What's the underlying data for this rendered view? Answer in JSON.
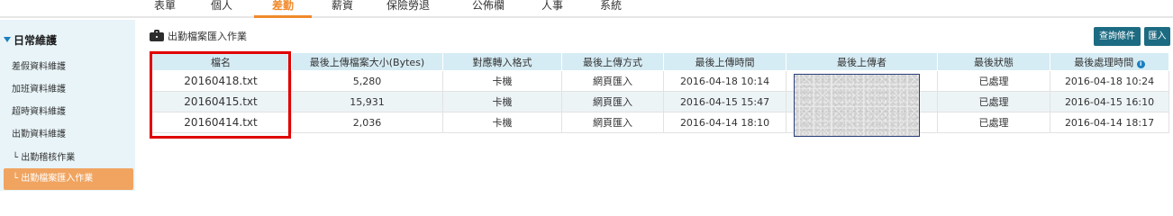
{
  "topnav": {
    "items": [
      {
        "label": "表單"
      },
      {
        "label": "個人"
      },
      {
        "label": "差勤"
      },
      {
        "label": "薪資"
      },
      {
        "label": "保險勞退"
      },
      {
        "label": "公佈欄"
      },
      {
        "label": "人事"
      },
      {
        "label": "系統"
      }
    ],
    "active_index": 2,
    "accent_color": "#f0892a"
  },
  "sidebar": {
    "section_label": "日常維護",
    "items": [
      {
        "label": "差假資料維護"
      },
      {
        "label": "加班資料維護"
      },
      {
        "label": "超時資料維護"
      },
      {
        "label": "出勤資料維護"
      },
      {
        "label": "└ 出勤稽核作業"
      },
      {
        "label": "└ 出勤檔案匯入作業"
      }
    ],
    "active_color": "#f0a460"
  },
  "main": {
    "title": "出勤檔案匯入作業",
    "title_icon": "briefcase-icon",
    "query_button": "查詢條件",
    "import_button": "匯入",
    "button_color": "#1c6b82"
  },
  "table": {
    "headers": [
      "檔名",
      "最後上傳檔案大小(Bytes)",
      "對應轉入格式",
      "最後上傳方式",
      "最後上傳時間",
      "最後上傳者",
      "最後狀態",
      "最後處理時間"
    ],
    "rows": [
      [
        "20160418.txt",
        "5,280",
        "卡機",
        "網頁匯入",
        "2016-04-18 10:14",
        "",
        "已處理",
        "2016-04-18 10:24"
      ],
      [
        "20160415.txt",
        "15,931",
        "卡機",
        "網頁匯入",
        "2016-04-15 15:47",
        "",
        "已處理",
        "2016-04-15 16:10"
      ],
      [
        "20160414.txt",
        "2,036",
        "卡機",
        "網頁匯入",
        "2016-04-14 18:10",
        "",
        "已處理",
        "2016-04-14 18:17"
      ]
    ],
    "info_icon": "i",
    "header_bg": "#d6ecf4"
  },
  "annotation": {
    "highlight_color": "#e00000"
  }
}
